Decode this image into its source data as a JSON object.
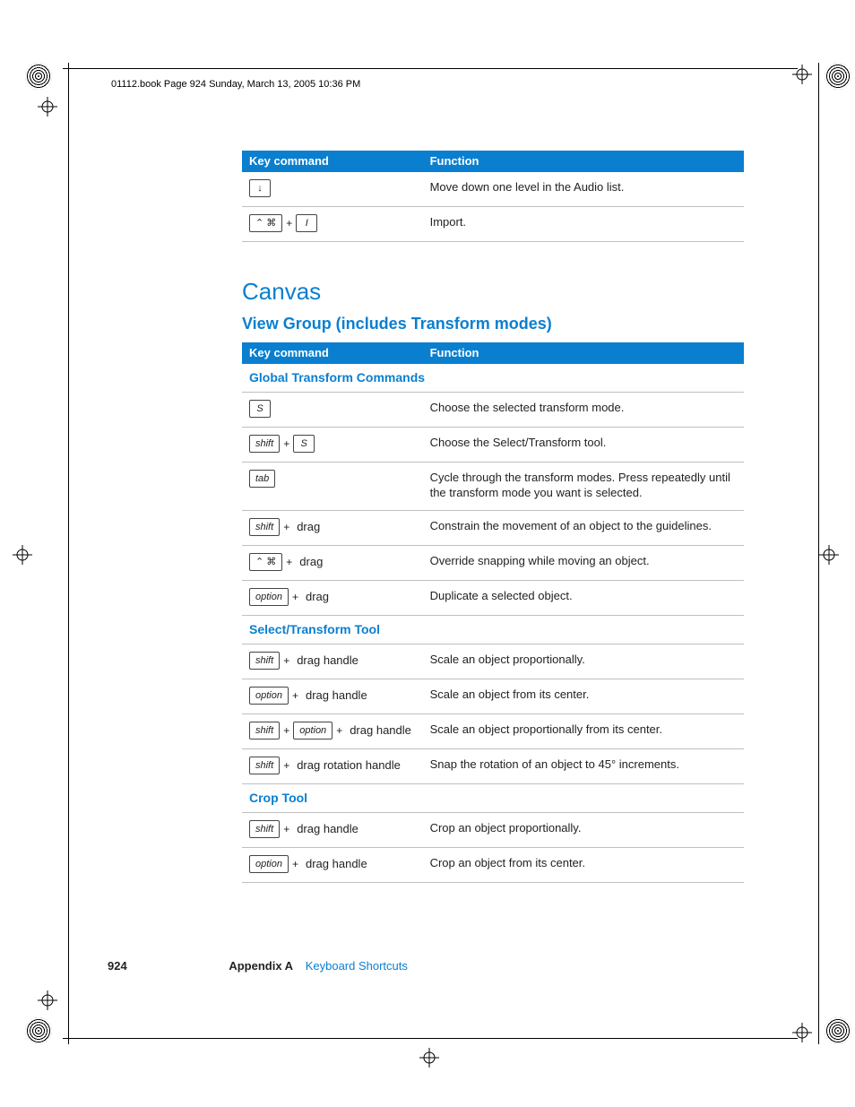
{
  "header_line": "01112.book  Page 924  Sunday, March 13, 2005  10:36 PM",
  "table1": {
    "head_key": "Key command",
    "head_fn": "Function",
    "rows": [
      {
        "keys": [
          {
            "type": "key",
            "label": "↓",
            "upright": true
          }
        ],
        "fn": "Move down one level in the Audio list."
      },
      {
        "keys": [
          {
            "type": "key",
            "label": "⌃  ⌘",
            "upright": true
          },
          {
            "type": "plus"
          },
          {
            "type": "key",
            "label": "I"
          }
        ],
        "fn": "Import."
      }
    ]
  },
  "section_h1": "Canvas",
  "section_h2": "View Group (includes Transform modes)",
  "table2": {
    "head_key": "Key command",
    "head_fn": "Function",
    "groups": [
      {
        "subhead": "Global Transform Commands",
        "rows": [
          {
            "keys": [
              {
                "type": "key",
                "label": "S"
              }
            ],
            "fn": "Choose the selected transform mode."
          },
          {
            "keys": [
              {
                "type": "key",
                "label": "shift"
              },
              {
                "type": "plus"
              },
              {
                "type": "key",
                "label": "S"
              }
            ],
            "fn": "Choose the Select/Transform tool."
          },
          {
            "keys": [
              {
                "type": "key",
                "label": "tab"
              }
            ],
            "fn": "Cycle through the transform modes. Press repeatedly until the transform mode you want is selected."
          },
          {
            "keys": [
              {
                "type": "key",
                "label": "shift"
              },
              {
                "type": "plus"
              },
              {
                "type": "action",
                "label": "drag"
              }
            ],
            "fn": "Constrain the movement of an object to the guidelines."
          },
          {
            "keys": [
              {
                "type": "key",
                "label": "⌃  ⌘",
                "upright": true
              },
              {
                "type": "plus"
              },
              {
                "type": "action",
                "label": "drag"
              }
            ],
            "fn": "Override snapping while moving an object."
          },
          {
            "keys": [
              {
                "type": "key",
                "label": "option"
              },
              {
                "type": "plus"
              },
              {
                "type": "action",
                "label": "drag"
              }
            ],
            "fn": "Duplicate a selected object."
          }
        ]
      },
      {
        "subhead": "Select/Transform Tool",
        "rows": [
          {
            "keys": [
              {
                "type": "key",
                "label": "shift"
              },
              {
                "type": "plus"
              },
              {
                "type": "action",
                "label": "drag handle"
              }
            ],
            "fn": "Scale an object proportionally."
          },
          {
            "keys": [
              {
                "type": "key",
                "label": "option"
              },
              {
                "type": "plus"
              },
              {
                "type": "action",
                "label": "drag handle"
              }
            ],
            "fn": "Scale an object from its center."
          },
          {
            "keys": [
              {
                "type": "key",
                "label": "shift"
              },
              {
                "type": "plus"
              },
              {
                "type": "key",
                "label": "option"
              },
              {
                "type": "plus"
              },
              {
                "type": "action",
                "label": "drag handle"
              }
            ],
            "fn": "Scale an object proportionally from its center."
          },
          {
            "keys": [
              {
                "type": "key",
                "label": "shift"
              },
              {
                "type": "plus"
              },
              {
                "type": "action",
                "label": "drag rotation handle"
              }
            ],
            "fn": "Snap the rotation of an object to 45° increments."
          }
        ]
      },
      {
        "subhead": "Crop Tool",
        "rows": [
          {
            "keys": [
              {
                "type": "key",
                "label": "shift"
              },
              {
                "type": "plus"
              },
              {
                "type": "action",
                "label": "drag handle"
              }
            ],
            "fn": "Crop an object proportionally."
          },
          {
            "keys": [
              {
                "type": "key",
                "label": "option"
              },
              {
                "type": "plus"
              },
              {
                "type": "action",
                "label": "drag handle"
              }
            ],
            "fn": "Crop an object from its center."
          }
        ]
      }
    ]
  },
  "footer": {
    "page": "924",
    "appendix": "Appendix A",
    "title": "Keyboard Shortcuts"
  }
}
